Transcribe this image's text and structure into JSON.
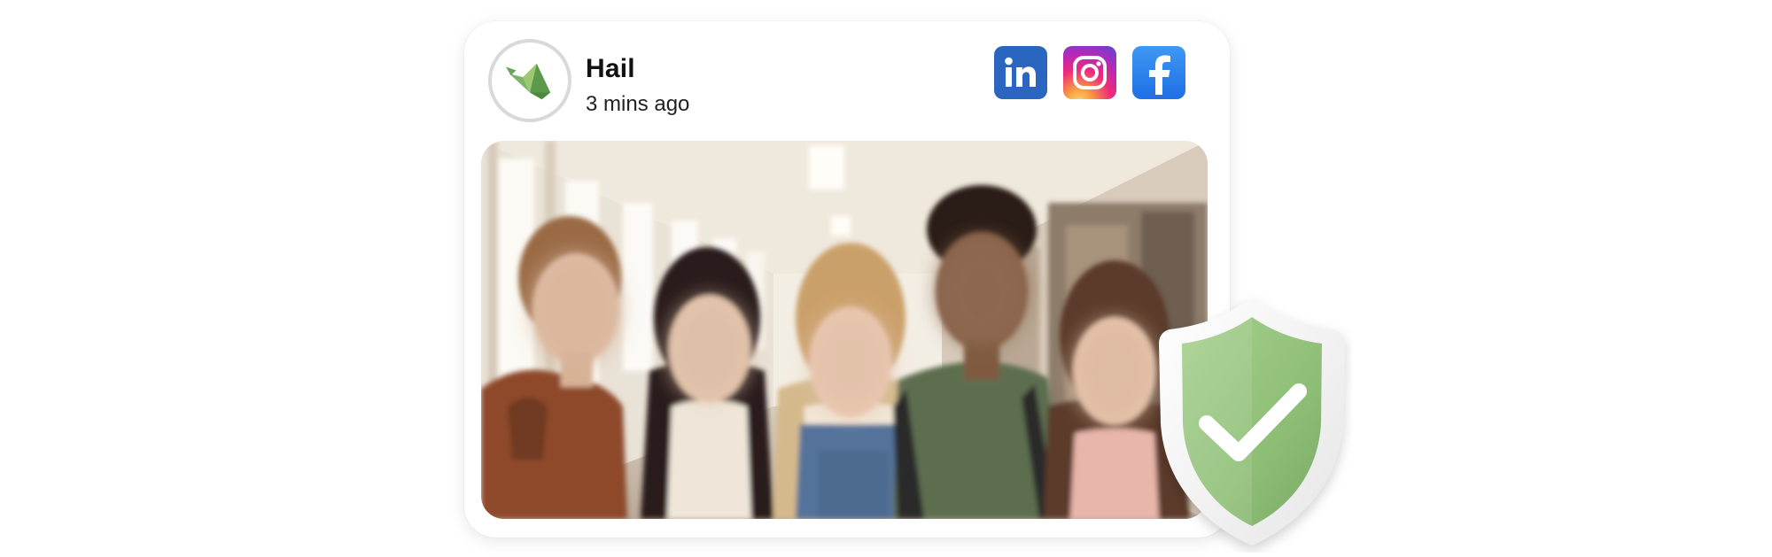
{
  "post": {
    "account_name": "Hail",
    "timestamp": "3 mins ago",
    "avatar_icon": "hail-bird-logo-icon",
    "image_icon": "group-photo"
  },
  "share": [
    {
      "name": "linkedin-icon",
      "label": "in",
      "color": "#2a66c0"
    },
    {
      "name": "instagram-icon",
      "color": "#ee2a7b"
    },
    {
      "name": "facebook-icon",
      "label": "f",
      "color": "#1f6fe5"
    }
  ],
  "badge": {
    "icon": "shield-check-icon",
    "color": "#8fbf77"
  }
}
